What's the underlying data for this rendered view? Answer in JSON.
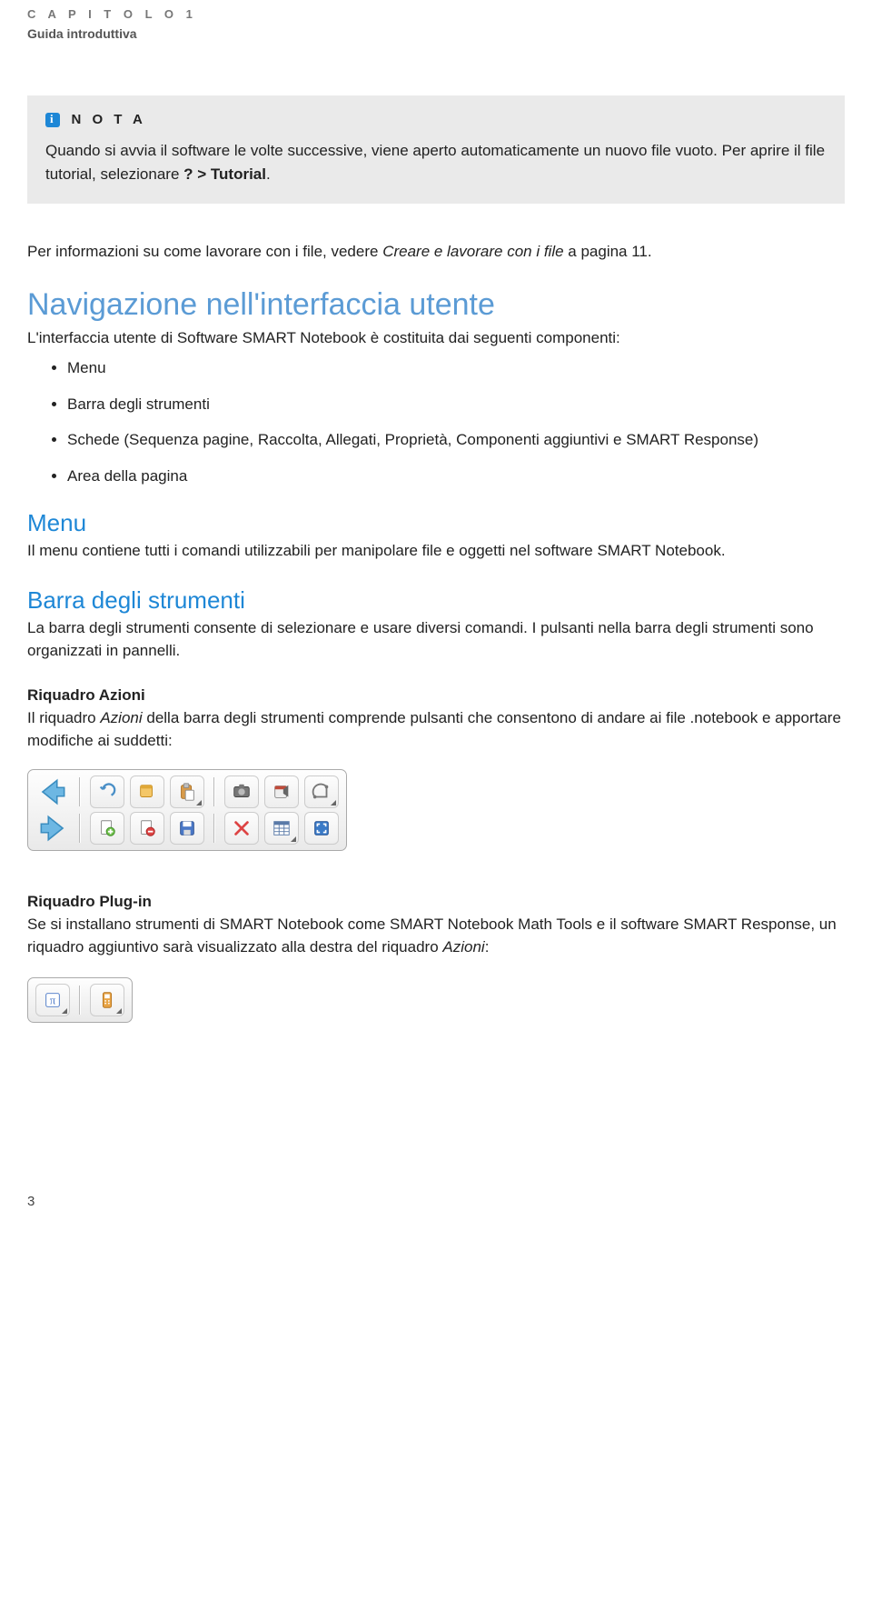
{
  "header": {
    "chapter": "C A P I T O L O 1",
    "subtitle": "Guida introduttiva"
  },
  "note": {
    "title": "N O T A",
    "body_pre": "Quando si avvia il software le volte successive, viene aperto automaticamente un nuovo file vuoto.",
    "body_mid": "Per aprire il file tutorial, selezionare ",
    "body_bold": "? > Tutorial",
    "body_end": "."
  },
  "preinfo": {
    "pre": "Per informazioni su come lavorare con i file, vedere ",
    "ital": "Creare e lavorare con i file",
    "post": " a pagina 11."
  },
  "nav": {
    "title": "Navigazione nell'interfaccia utente",
    "intro": "L'interfaccia utente di Software SMART Notebook è costituita dai seguenti componenti:",
    "items": [
      "Menu",
      "Barra degli strumenti",
      "Schede (Sequenza pagine, Raccolta, Allegati, Proprietà, Componenti aggiuntivi e SMART Response)",
      "Area della pagina"
    ]
  },
  "menu": {
    "title": "Menu",
    "body": "Il menu contiene tutti i comandi utilizzabili per manipolare file e oggetti nel software SMART Notebook."
  },
  "toolbar": {
    "title": "Barra degli strumenti",
    "body": "La barra degli strumenti consente di selezionare e usare diversi comandi. I pulsanti nella barra degli strumenti sono organizzati in pannelli."
  },
  "azioni": {
    "title": "Riquadro Azioni",
    "body_pre": "Il riquadro ",
    "body_ital": "Azioni",
    "body_post": " della barra degli strumenti comprende pulsanti che consentono di andare ai file .notebook e apportare modifiche ai suddetti:"
  },
  "plugin": {
    "title": "Riquadro Plug-in",
    "body_pre": "Se si installano strumenti di SMART Notebook come SMART Notebook Math Tools e il software SMART Response, un riquadro aggiuntivo sarà visualizzato alla destra del riquadro ",
    "body_ital": "Azioni",
    "body_post": ":"
  },
  "pagenum": "3"
}
